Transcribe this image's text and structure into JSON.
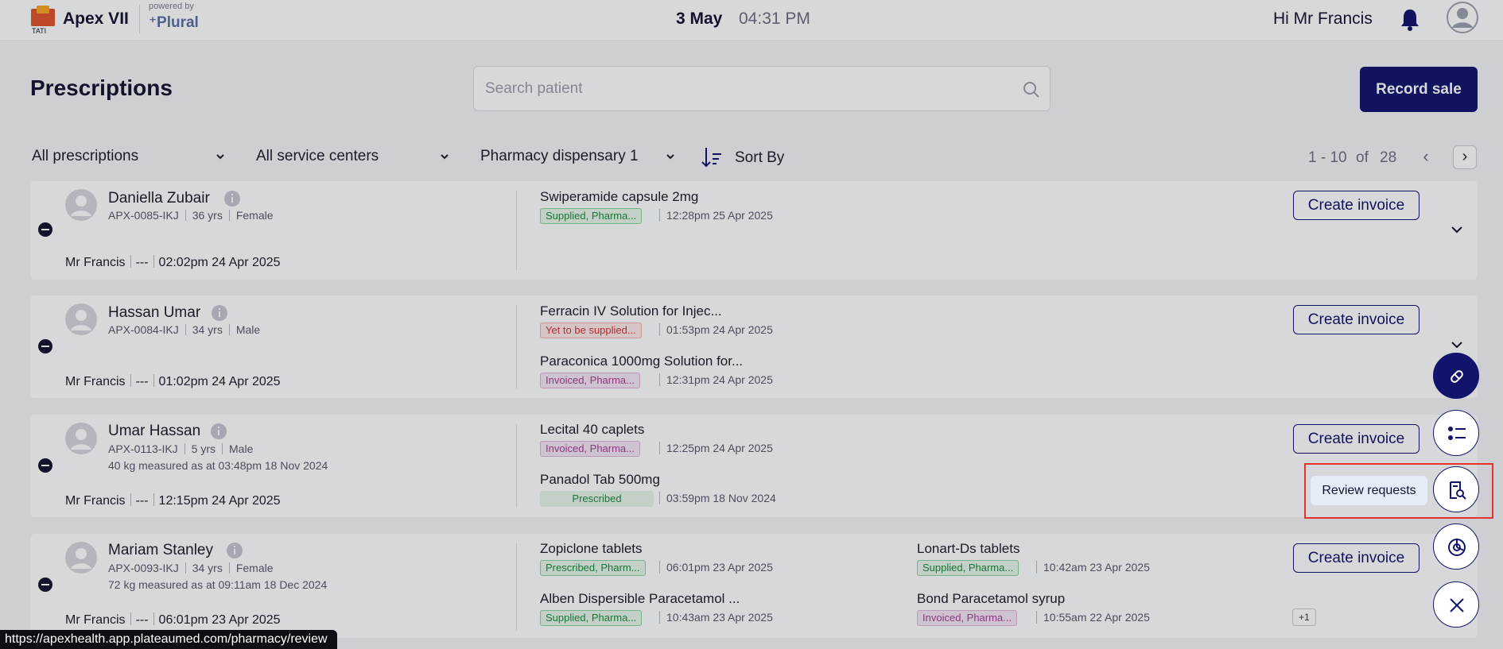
{
  "header": {
    "brand": "Apex VII",
    "powered_by": "powered by",
    "partner": "Plural",
    "date": "3 May",
    "time": "04:31 PM",
    "greeting": "Hi Mr Francis"
  },
  "page": {
    "title": "Prescriptions",
    "search_placeholder": "Search patient",
    "record_sale_label": "Record sale"
  },
  "filters": {
    "prescriptions": "All prescriptions",
    "service_centers": "All service centers",
    "dispensary": "Pharmacy dispensary 1",
    "sort_label": "Sort By"
  },
  "pagination": {
    "range": "1 - 10",
    "of": "of",
    "total": "28"
  },
  "cards": [
    {
      "name": "Daniella Zubair",
      "id": "APX-0085-IKJ",
      "age": "36 yrs",
      "sex": "Female",
      "extra": "",
      "doctor": "Mr Francis",
      "dash": "---",
      "created": "02:02pm 24 Apr 2025",
      "invoice_label": "Create invoice",
      "drugs": [
        {
          "name": "Swiperamide capsule 2mg",
          "status": "Supplied, Pharma...",
          "time": "12:28pm 25 Apr 2025"
        }
      ]
    },
    {
      "name": "Hassan Umar",
      "id": "APX-0084-IKJ",
      "age": "34 yrs",
      "sex": "Male",
      "extra": "",
      "doctor": "Mr Francis",
      "dash": "---",
      "created": "01:02pm 24 Apr 2025",
      "invoice_label": "Create invoice",
      "drugs": [
        {
          "name": "Ferracin IV Solution for Injec...",
          "status": "Yet to be supplied...",
          "time": "01:53pm 24 Apr 2025"
        },
        {
          "name": "Paraconica 1000mg Solution for...",
          "status": "Invoiced, Pharma...",
          "time": "12:31pm 24 Apr 2025"
        }
      ]
    },
    {
      "name": "Umar Hassan",
      "id": "APX-0113-IKJ",
      "age": "5 yrs",
      "sex": "Male",
      "extra": "40 kg measured as at 03:48pm 18 Nov 2024",
      "doctor": "Mr Francis",
      "dash": "---",
      "created": "12:15pm 24 Apr 2025",
      "invoice_label": "Create invoice",
      "drugs": [
        {
          "name": "Lecital 40 caplets",
          "status": "Invoiced, Pharma...",
          "time": "12:25pm 24 Apr 2025"
        },
        {
          "name": "Panadol Tab 500mg",
          "status": "Prescribed",
          "time": "03:59pm 18 Nov 2024"
        }
      ]
    },
    {
      "name": "Mariam Stanley",
      "id": "APX-0093-IKJ",
      "age": "34 yrs",
      "sex": "Female",
      "extra": "72 kg measured as at 09:11am 18 Dec 2024",
      "doctor": "Mr Francis",
      "dash": "---",
      "created": "06:01pm 23 Apr 2025",
      "invoice_label": "Create invoice",
      "more": "+1",
      "drugs": [
        {
          "name": "Zopiclone tablets",
          "status": "Prescribed, Pharm...",
          "time": "06:01pm 23 Apr 2025"
        },
        {
          "name": "Alben Dispersible Paracetamol ...",
          "status": "Supplied, Pharma...",
          "time": "10:43am 23 Apr 2025"
        },
        {
          "name": "Lonart-Ds tablets",
          "status": "Supplied, Pharma...",
          "time": "10:42am 23 Apr 2025"
        },
        {
          "name": "Bond Paracetamol syrup",
          "status": "Invoiced, Pharma...",
          "time": "10:55am 22 Apr 2025"
        }
      ]
    }
  ],
  "fab": {
    "tooltip": "Review requests"
  },
  "status_url": "https://apexhealth.app.plateaumed.com/pharmacy/review"
}
